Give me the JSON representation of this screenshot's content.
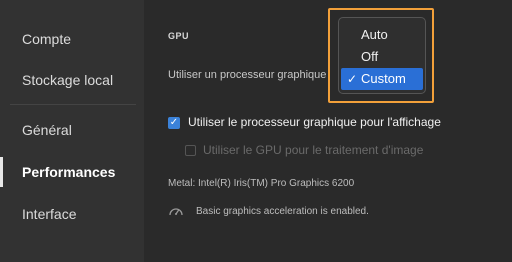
{
  "sidebar": {
    "items": [
      {
        "label": "Compte"
      },
      {
        "label": "Stockage local"
      },
      {
        "label": "Général"
      },
      {
        "label": "Performances"
      },
      {
        "label": "Interface"
      }
    ]
  },
  "main": {
    "section_title": "GPU",
    "gpu_row_label": "Utiliser un processeur graphique",
    "checkbox_display": {
      "label": "Utiliser le processeur graphique pour l'affichage",
      "checked": true
    },
    "checkbox_image": {
      "label": "Utiliser le GPU pour le traitement d'image",
      "checked": false,
      "disabled": true
    },
    "metal_info": "Metal: Intel(R) Iris(TM) Pro Graphics 6200",
    "status_text": "Basic graphics acceleration is enabled."
  },
  "dropdown": {
    "options": [
      "Auto",
      "Off",
      "Custom"
    ],
    "selected": "Custom",
    "checkmark": "✓"
  },
  "colors": {
    "accent": "#2a6fd6",
    "highlight_border": "#f2a03a",
    "checkbox": "#3b82d9"
  }
}
